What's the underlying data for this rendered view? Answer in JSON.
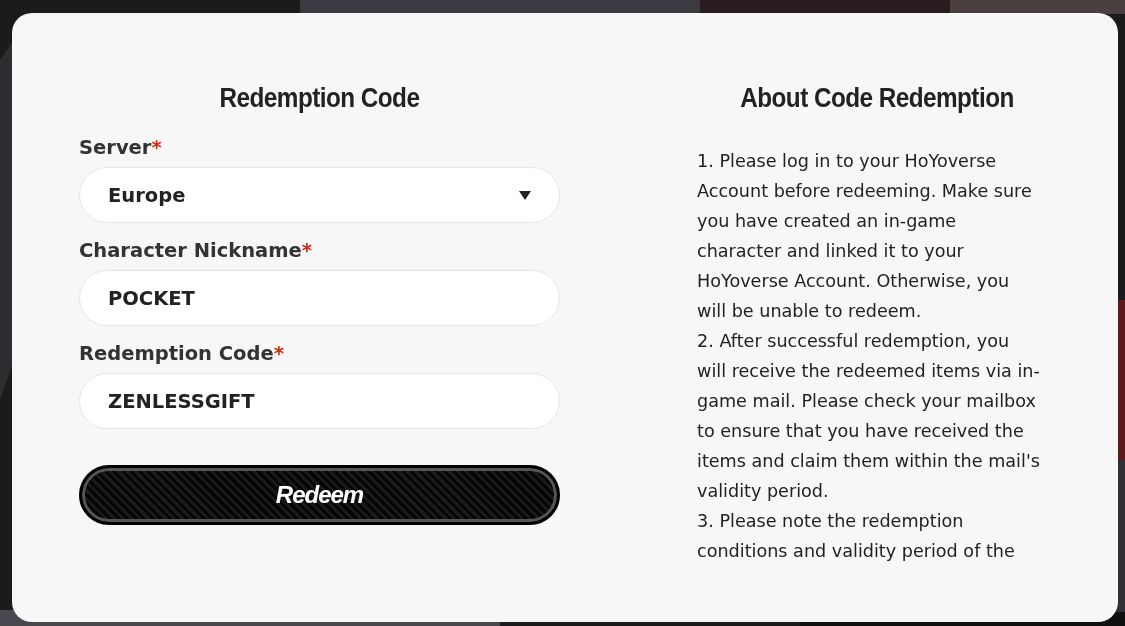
{
  "form": {
    "title": "Redemption Code",
    "fields": [
      {
        "kind": "select",
        "label": "Server",
        "marker": "*",
        "value": "Europe"
      },
      {
        "kind": "text",
        "label": "Character Nickname",
        "marker": "*",
        "value": "POCKET"
      },
      {
        "kind": "text",
        "label": "Redemption Code",
        "marker": "*",
        "value": "ZENLESSGIFT"
      }
    ],
    "button": "Redeem"
  },
  "about": {
    "title": "About Code Redemption",
    "paragraphs": [
      "1. Please log in to your HoYoverse Account before redeeming. Make sure you have created an in-game character and linked it to your HoYoverse Account. Otherwise, you will be unable to redeem.",
      "2. After successful redemption, you will receive the redeemed items via in-game mail. Please check your mailbox to ensure that you have received the items and claim them within the mail's validity period.",
      "3. Please note the redemption conditions and validity period of the"
    ]
  }
}
